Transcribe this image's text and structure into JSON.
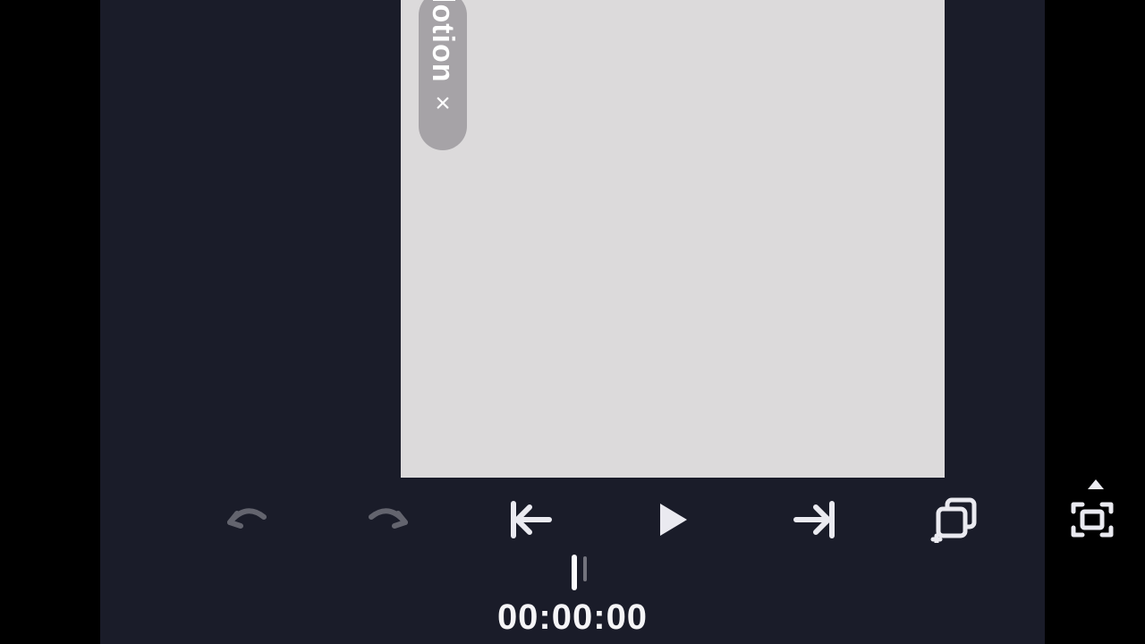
{
  "effect_pill": {
    "label": "lotion",
    "close_glyph": "×"
  },
  "timeline": {
    "timecode": "00:00:00"
  },
  "icons": {
    "undo": "undo-icon",
    "redo": "redo-icon",
    "prev": "skip-back-icon",
    "play": "play-icon",
    "next": "skip-forward-icon",
    "add_layer": "add-layer-icon",
    "fullscreen": "fullscreen-icon",
    "caret": "caret-up-icon"
  },
  "colors": {
    "stage_bg": "#1a1c29",
    "canvas_bg": "#dcdadb",
    "pill_bg": "#a6a3a7",
    "icon": "#eaeaf0",
    "icon_dim": "#5a5b66"
  }
}
